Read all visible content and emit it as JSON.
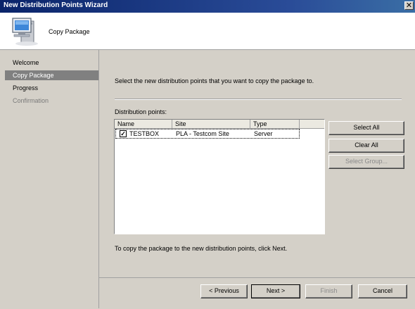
{
  "window": {
    "title": "New Distribution Points Wizard",
    "close_symbol": "✕"
  },
  "header": {
    "title": "Copy Package",
    "icon": "computer-icon"
  },
  "sidebar": {
    "items": [
      {
        "label": "Welcome",
        "state": "normal"
      },
      {
        "label": "Copy Package",
        "state": "active"
      },
      {
        "label": "Progress",
        "state": "normal"
      },
      {
        "label": "Confirmation",
        "state": "disabled"
      }
    ]
  },
  "main": {
    "instruction": "Select the new distribution points that you want to copy the package to.",
    "dp_label": "Distribution points:",
    "columns": [
      "Name",
      "Site",
      "Type"
    ],
    "rows": [
      {
        "checked": true,
        "name": "TESTBOX",
        "site": "PLA - Testcom Site",
        "type": "Server"
      }
    ],
    "footer_text": "To copy the package to the new distribution points, click Next."
  },
  "side_buttons": {
    "select_all": "Select All",
    "clear_all": "Clear All",
    "select_group": "Select Group..."
  },
  "nav_buttons": {
    "previous": "< Previous",
    "next": "Next >",
    "finish": "Finish",
    "cancel": "Cancel"
  },
  "colors": {
    "titlebar": "#0a246a",
    "active_nav": "#808080",
    "face": "#d4d0c8"
  }
}
